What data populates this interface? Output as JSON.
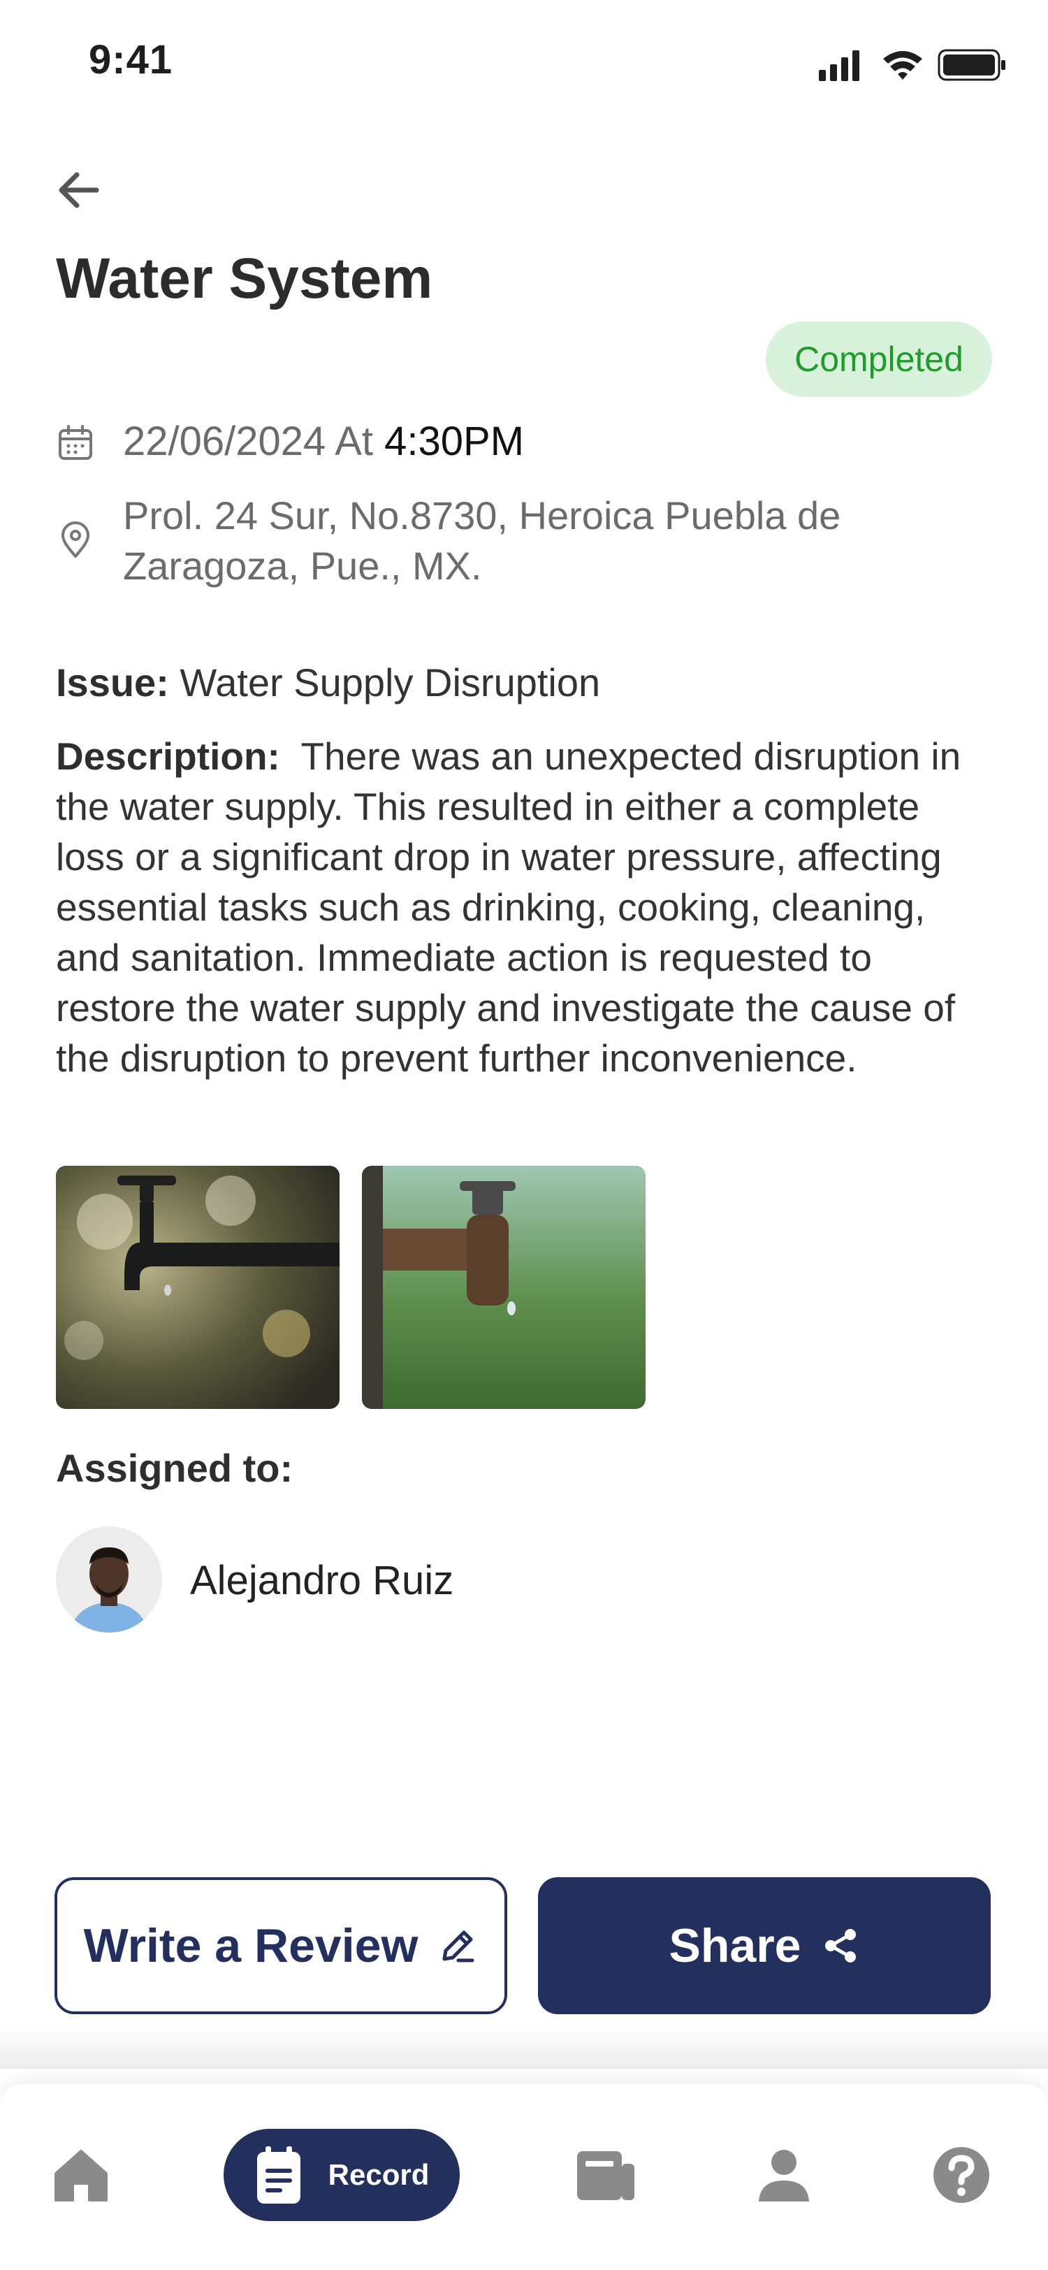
{
  "status_bar": {
    "time": "9:41"
  },
  "header": {
    "title": "Water System",
    "status": "Completed"
  },
  "details": {
    "date": "22/06/2024 At",
    "time": "4:30PM",
    "address": "Prol. 24 Sur, No.8730, Heroica Puebla de Zaragoza, Pue., MX."
  },
  "issue": {
    "label": "Issue:",
    "value": "Water Supply Disruption"
  },
  "description": {
    "label": "Description:",
    "value": "There was an unexpected disruption in the water supply. This resulted in either a complete loss or a significant drop in water pressure, affecting essential tasks such as drinking, cooking, cleaning, and sanitation. Immediate action is requested to restore the water supply and investigate the cause of the disruption to prevent further inconvenience."
  },
  "assigned": {
    "label": "Assigned to:",
    "name": "Alejandro Ruiz"
  },
  "actions": {
    "review_label": "Write a Review",
    "share_label": "Share"
  },
  "nav": {
    "items": [
      {
        "icon": "home-icon"
      },
      {
        "icon": "record-icon",
        "label": "Record",
        "active": true
      },
      {
        "icon": "news-icon"
      },
      {
        "icon": "profile-icon"
      },
      {
        "icon": "help-icon"
      }
    ]
  },
  "colors": {
    "primary": "#232f5c",
    "badge_bg": "#d9f2db",
    "badge_text": "#1f9b2a"
  }
}
